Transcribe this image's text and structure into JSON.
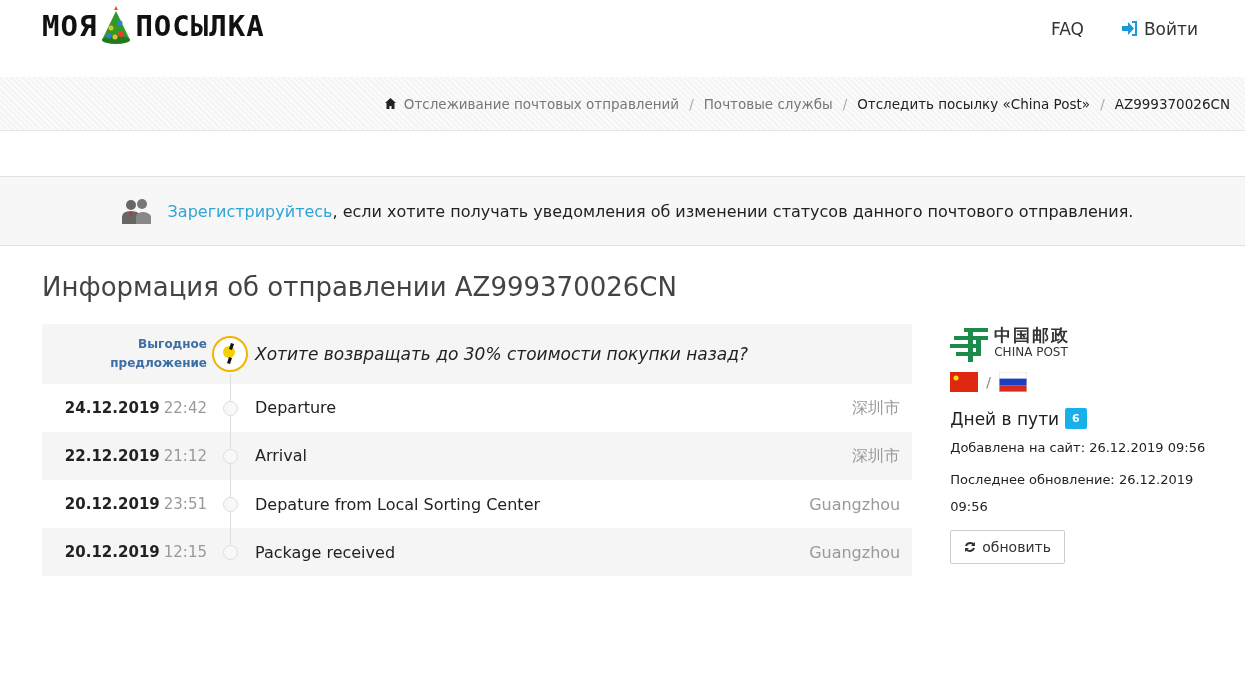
{
  "header": {
    "logo_left": "МОЯ",
    "logo_right": "ПОСЫЛКА",
    "nav": [
      {
        "label": "FAQ",
        "kind": "link"
      },
      {
        "label": "Войти",
        "kind": "login"
      }
    ]
  },
  "breadcrumbs": [
    {
      "label": "Отслеживание почтовых отправлений",
      "current": false
    },
    {
      "separator": "/",
      "label": "Почтовые службы",
      "current": false
    },
    {
      "separator": "/",
      "label": "Отследить посылку «China Post»",
      "current": true
    },
    {
      "separator": "/",
      "label": "AZ999370026CN",
      "current": true
    }
  ],
  "notice": {
    "link": "Зарегистрируйтесь",
    "text": ", если хотите получать уведомления об изменении статусов данного почтового отправления."
  },
  "title": "Информация об отправлении AZ999370026CN",
  "offer": {
    "label": "Выгодное предложение",
    "text": "Хотите возвращать до 30% стоимости покупки назад?"
  },
  "events": [
    {
      "date": "24.12.2019",
      "time": "22:42",
      "status": "Departure",
      "place": "深圳市"
    },
    {
      "date": "22.12.2019",
      "time": "21:12",
      "status": "Arrival",
      "place": "深圳市"
    },
    {
      "date": "20.12.2019",
      "time": "23:51",
      "status": "Depature from Local Sorting Center",
      "place": "Guangzhou"
    },
    {
      "date": "20.12.2019",
      "time": "12:15",
      "status": "Package received",
      "place": "Guangzhou"
    }
  ],
  "carrier": {
    "name_cn": "中国邮政",
    "name_en": "CHINA POST"
  },
  "route_separator": "/",
  "days": {
    "label": "Дней в пути",
    "count": "6"
  },
  "added": "Добавлена на сайт: 26.12.2019 09:56",
  "updated": "Последнее обновление: 26.12.2019 09:56",
  "refresh_button": "обновить"
}
